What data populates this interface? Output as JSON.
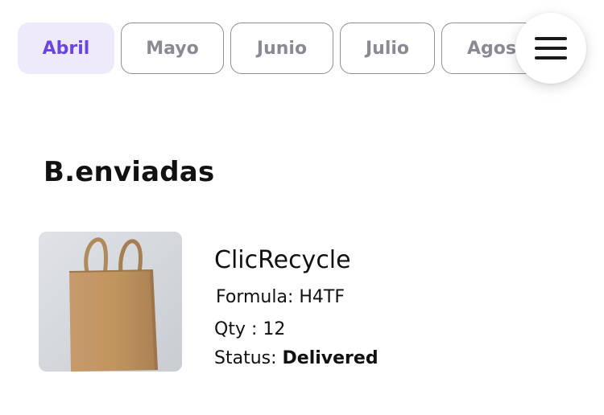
{
  "month_tabs": [
    {
      "label": "Abril",
      "active": true
    },
    {
      "label": "Mayo",
      "active": false
    },
    {
      "label": "Junio",
      "active": false
    },
    {
      "label": "Julio",
      "active": false
    },
    {
      "label": "Agosto",
      "active": false
    }
  ],
  "menu": {
    "icon": "hamburger-menu-icon"
  },
  "section": {
    "title": "B.enviadas"
  },
  "product": {
    "name": "ClicRecycle",
    "formula_label": "Formula: ",
    "formula_value": "H4TF",
    "qty_label": "Qty : ",
    "qty_value": "12",
    "status_label": "Status: ",
    "status_value": "Delivered",
    "image": "kraft-paper-tote-bag"
  },
  "colors": {
    "accent": "#6a45e3",
    "active_tab_bg": "#eeeafc",
    "tab_border": "#8f8f96",
    "tab_text": "#8a8a94",
    "text": "#111111"
  }
}
